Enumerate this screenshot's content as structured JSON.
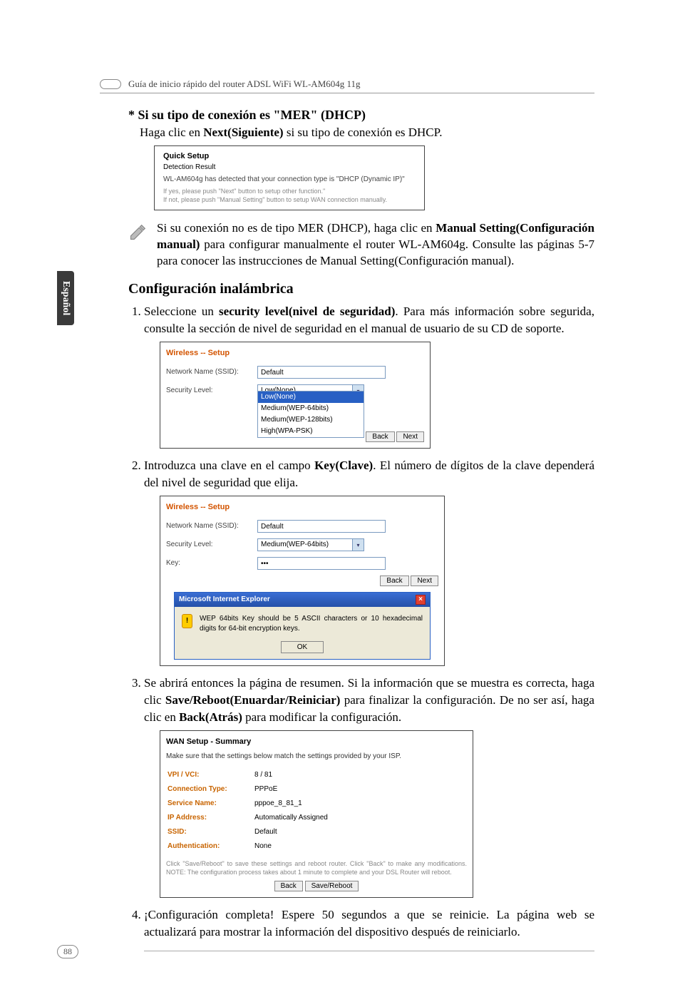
{
  "header": {
    "guide_title": "Guía de inicio rápido del router ADSL WiFi WL-AM604g 11g"
  },
  "side_tab": "Español",
  "sec1": {
    "heading": "* Si su tipo de conexión es \"MER\" (DHCP)",
    "line": "Haga clic en ",
    "line_bold": "Next(Siguiente)",
    "line_tail": " si su tipo de conexión es DHCP.",
    "shot": {
      "title": "Quick Setup",
      "subtitle": "Detection Result",
      "detect": "WL-AM604g has detected that your connection type is \"DHCP (Dynamic IP)\"",
      "hint1": "If yes, please push \"Next\" button to setup other function.\"",
      "hint2": "If not, please push \"Manual Setting\" button to setup WAN connection manually."
    },
    "note": {
      "p1_a": "Si su conexión no es de tipo MER (DHCP), haga clic en ",
      "p1_bold": "Manual Setting(Configuración manual)",
      "p1_b": " para configurar manualmente el router WL-AM604g. Consulte las páginas 5-7 para conocer las instrucciones de Manual Setting(Configuración manual)."
    }
  },
  "sec2": {
    "heading": "Configuración inalámbrica",
    "step1_a": "Seleccione un ",
    "step1_bold": "security level(nivel de seguridad)",
    "step1_b": ". Para más información sobre segurida, consulte la sección de nivel de seguridad en el manual de usuario de su CD de soporte.",
    "ws1": {
      "title": "Wireless -- Setup",
      "ssid_label": "Network Name (SSID):",
      "ssid_value": "Default",
      "sec_label": "Security Level:",
      "sec_value": "Low(None)",
      "options": [
        "Low(None)",
        "Medium(WEP-64bits)",
        "Medium(WEP-128bits)",
        "High(WPA-PSK)"
      ],
      "back": "Back",
      "next": "Next"
    },
    "step2_a": "Introduzca una clave en el campo ",
    "step2_bold": "Key(Clave)",
    "step2_b": ". El número de dígitos de la clave dependerá del nivel de seguridad que elija.",
    "ws2": {
      "title": "Wireless -- Setup",
      "ssid_label": "Network Name (SSID):",
      "ssid_value": "Default",
      "sec_label": "Security Level:",
      "sec_value": "Medium(WEP-64bits)",
      "key_label": "Key:",
      "key_value": "•••",
      "back": "Back",
      "next": "Next",
      "ie_title": "Microsoft Internet Explorer",
      "ie_msg": "WEP 64bits Key should be 5 ASCII characters or 10 hexadecimal digits for 64-bit encryption keys.",
      "ie_ok": "OK"
    },
    "step3_a": "Se abrirá entonces la página de resumen. Si la información que se muestra es correcta, haga clic ",
    "step3_bold1": "Save/Reboot(Enuardar/Reiniciar)",
    "step3_b": " para finalizar la configuración. De no ser así, haga clic en ",
    "step3_bold2": "Back(Atrás)",
    "step3_c": " para modificar la configuración.",
    "summary": {
      "title": "WAN Setup - Summary",
      "desc": "Make sure that the settings below match the settings provided by your ISP.",
      "rows": [
        [
          "VPI / VCI:",
          "8 / 81"
        ],
        [
          "Connection Type:",
          "PPPoE"
        ],
        [
          "Service Name:",
          "pppoe_8_81_1"
        ],
        [
          "IP Address:",
          "Automatically Assigned"
        ],
        [
          "SSID:",
          "Default"
        ],
        [
          "Authentication:",
          "None"
        ]
      ],
      "note": "Click \"Save/Reboot\" to save these settings and reboot router. Click \"Back\" to make any modifications.\nNOTE: The configuration process takes about 1 minute to complete and your DSL Router will reboot.",
      "back": "Back",
      "save": "Save/Reboot"
    },
    "step4": "¡Configuración completa! Espere 50 segundos a que se reinicie. La página web se actualizará para mostrar la información del dispositivo después de reiniciarlo."
  },
  "page_number": "88"
}
